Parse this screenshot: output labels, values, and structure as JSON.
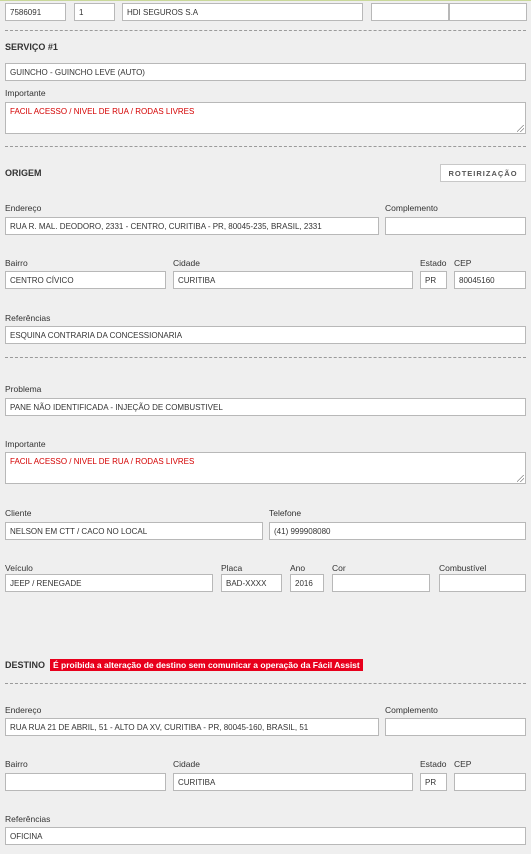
{
  "header": {
    "protocol": "7586091",
    "item": "1",
    "insurer": "HDI SEGUROS S.A",
    "extra1": "",
    "extra2": ""
  },
  "service": {
    "heading": "SERVIÇO #1",
    "type": "GUINCHO - GUINCHO LEVE (AUTO)",
    "important_label": "Importante",
    "important_value": "FACIL ACESSO / NIVEL DE RUA / RODAS LIVRES"
  },
  "origin": {
    "heading": "ORIGEM",
    "route_button": "ROTEIRIZAÇÃO",
    "address_label": "Endereço",
    "address_value": "RUA R. MAL. DEODORO, 2331 - CENTRO, CURITIBA - PR, 80045-235, BRASIL, 2331",
    "complement_label": "Complemento",
    "complement_value": "",
    "district_label": "Bairro",
    "district_value": "CENTRO CÍVICO",
    "city_label": "Cidade",
    "city_value": "CURITIBA",
    "state_label": "Estado",
    "state_value": "PR",
    "cep_label": "CEP",
    "cep_value": "80045160",
    "references_label": "Referências",
    "references_value": "ESQUINA CONTRARIA DA CONCESSIONARIA"
  },
  "details": {
    "problem_label": "Problema",
    "problem_value": "PANE NÃO IDENTIFICADA - INJEÇÃO DE COMBUSTIVEL",
    "important_label": "Importante",
    "important_value": "FACIL ACESSO / NIVEL DE RUA / RODAS LIVRES",
    "client_label": "Cliente",
    "client_value": "NELSON EM CTT / CACO NO LOCAL",
    "phone_label": "Telefone",
    "phone_value": "(41) 999908080",
    "vehicle_label": "Veículo",
    "vehicle_value": "JEEP / RENEGADE",
    "plate_label": "Placa",
    "plate_value": "BAD-XXXX",
    "year_label": "Ano",
    "year_value": "2016",
    "color_label": "Cor",
    "color_value": "",
    "fuel_label": "Combustível",
    "fuel_value": ""
  },
  "destination": {
    "heading": "DESTINO",
    "warning": "É proibida a alteração de destino sem comunicar a operação da Fácil Assist",
    "warning_color": "#e8001c",
    "address_label": "Endereço",
    "address_value": "RUA RUA 21 DE ABRIL, 51 - ALTO DA XV, CURITIBA - PR, 80045-160, BRASIL, 51",
    "complement_label": "Complemento",
    "complement_value": "",
    "district_label": "Bairro",
    "district_value": "",
    "city_label": "Cidade",
    "city_value": "CURITIBA",
    "state_label": "Estado",
    "state_value": "PR",
    "cep_label": "CEP",
    "cep_value": "",
    "references_label": "Referências",
    "references_value": "OFICINA"
  },
  "colors": {
    "important_text": "#d40000",
    "background": "#efefef"
  }
}
